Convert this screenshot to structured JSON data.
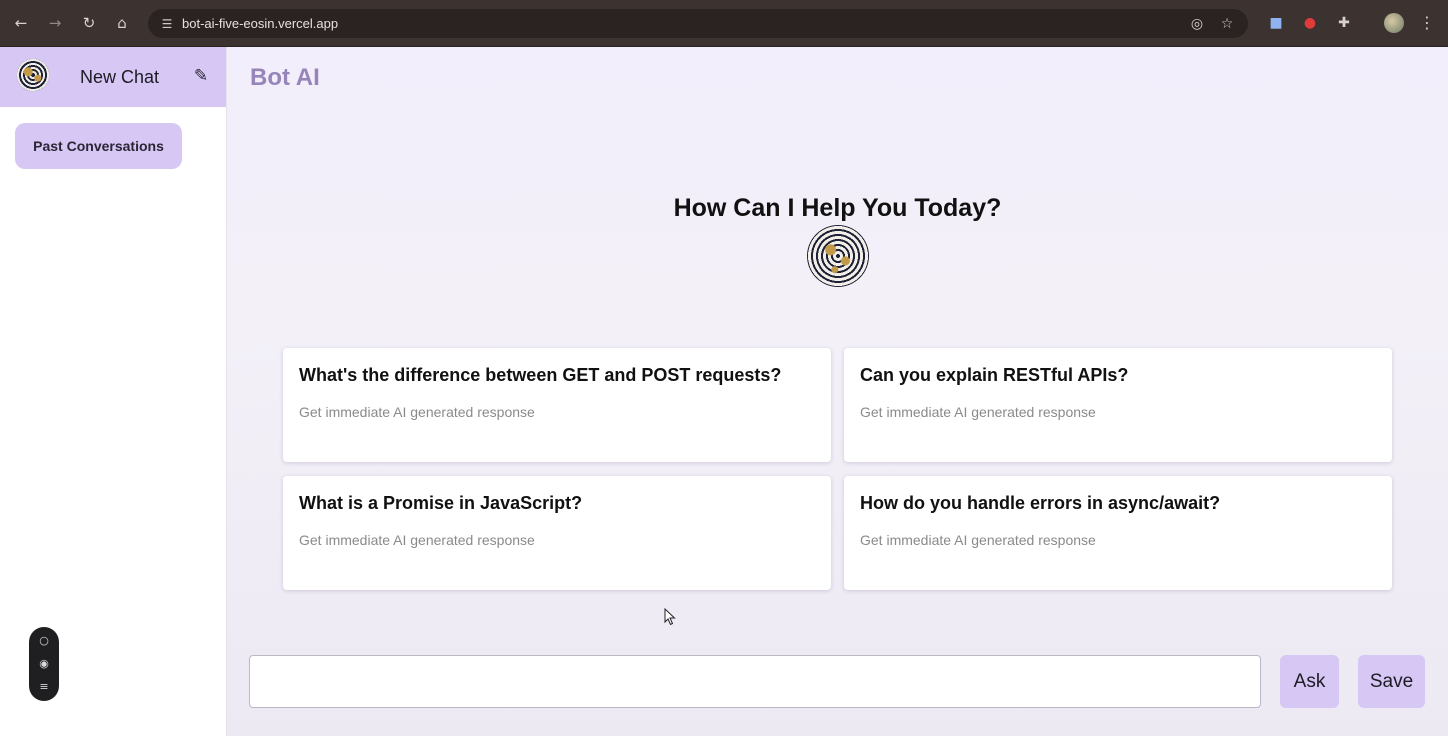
{
  "browser": {
    "url": "bot-ai-five-eosin.vercel.app",
    "icons": {
      "back": "←",
      "forward": "→",
      "reload": "↻",
      "home": "⌂",
      "site_info": "☰",
      "eye_off": "◎",
      "star": "☆",
      "ext1": "■",
      "ext2": "●",
      "ext3": "✚",
      "menu": "⋮"
    }
  },
  "sidebar": {
    "new_chat_label": "New Chat",
    "edit_icon": "✎",
    "past_conversations_label": "Past Conversations",
    "toolbar_icons": [
      "○",
      "◉",
      "≡"
    ]
  },
  "main": {
    "app_title": "Bot AI",
    "welcome_heading": "How Can I Help You Today?",
    "cards": [
      {
        "title": "What's the difference between GET and POST requests?",
        "subtitle": "Get immediate AI generated response"
      },
      {
        "title": "Can you explain RESTful APIs?",
        "subtitle": "Get immediate AI generated response"
      },
      {
        "title": "What is a Promise in JavaScript?",
        "subtitle": "Get immediate AI generated response"
      },
      {
        "title": "How do you handle errors in async/await?",
        "subtitle": "Get immediate AI generated response"
      }
    ],
    "input_value": "",
    "ask_label": "Ask",
    "save_label": "Save"
  },
  "colors": {
    "accent": "#d7c7f4",
    "title": "#9785ba",
    "browser_bar": "#3c3330"
  }
}
